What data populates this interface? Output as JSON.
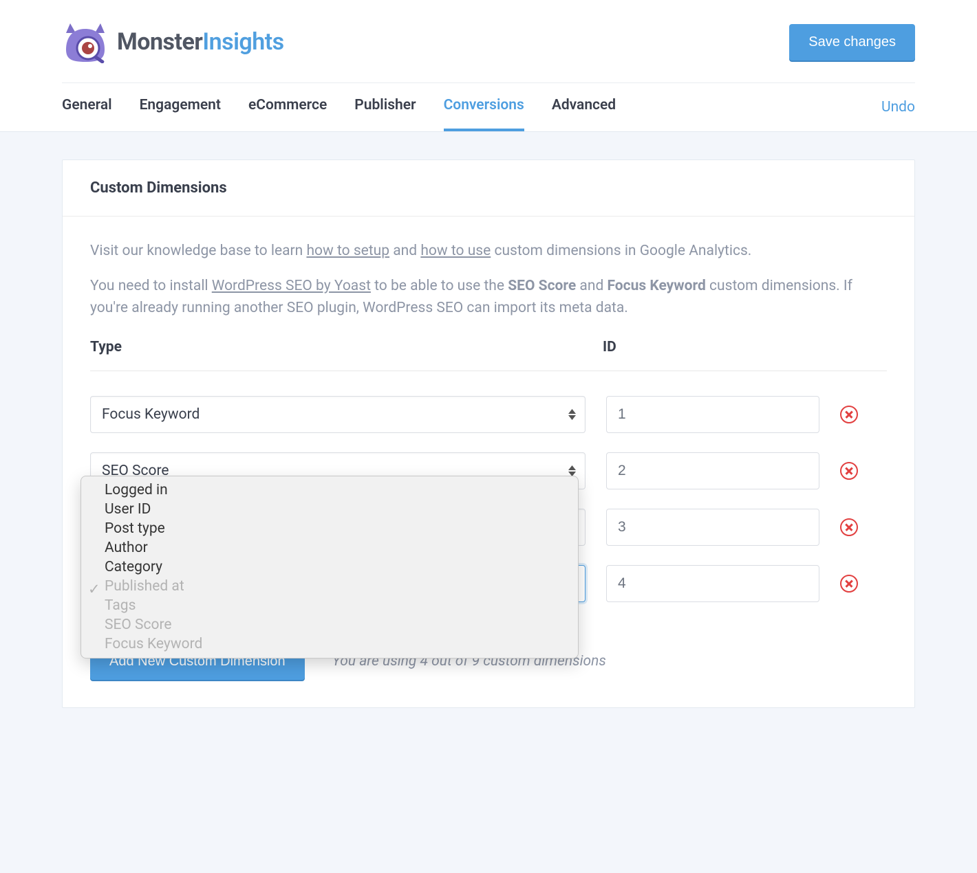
{
  "header": {
    "brand_main": "Monster",
    "brand_accent": "Insights",
    "save_button": "Save changes",
    "undo": "Undo"
  },
  "tabs": [
    {
      "label": "General",
      "active": false
    },
    {
      "label": "Engagement",
      "active": false
    },
    {
      "label": "eCommerce",
      "active": false
    },
    {
      "label": "Publisher",
      "active": false
    },
    {
      "label": "Conversions",
      "active": true
    },
    {
      "label": "Advanced",
      "active": false
    }
  ],
  "panel": {
    "title": "Custom Dimensions",
    "help1_before": "Visit our knowledge base to learn ",
    "help1_link1": "how to setup",
    "help1_mid": " and ",
    "help1_link2": "how to use",
    "help1_after": " custom dimensions in Google Analytics.",
    "help2_before": "You need to install ",
    "help2_link": "WordPress SEO by Yoast",
    "help2_mid1": " to be able to use the ",
    "help2_strong1": "SEO Score",
    "help2_mid2": " and ",
    "help2_strong2": "Focus Keyword",
    "help2_after": " custom dimensions. If you're already running another SEO plugin, WordPress SEO can import its meta data.",
    "col_type": "Type",
    "col_id": "ID"
  },
  "rows": [
    {
      "type": "Focus Keyword",
      "id": "1"
    },
    {
      "type": "SEO Score",
      "id": "2"
    },
    {
      "type": "",
      "id": "3"
    },
    {
      "type": "",
      "id": "4"
    }
  ],
  "dropdown": {
    "options": [
      {
        "label": "Logged in",
        "disabled": false,
        "checked": false
      },
      {
        "label": "User ID",
        "disabled": false,
        "checked": false
      },
      {
        "label": "Post type",
        "disabled": false,
        "checked": false
      },
      {
        "label": "Author",
        "disabled": false,
        "checked": false
      },
      {
        "label": "Category",
        "disabled": false,
        "checked": false
      },
      {
        "label": "Published at",
        "disabled": true,
        "checked": true
      },
      {
        "label": "Tags",
        "disabled": true,
        "checked": false
      },
      {
        "label": "SEO Score",
        "disabled": true,
        "checked": false
      },
      {
        "label": "Focus Keyword",
        "disabled": true,
        "checked": false
      }
    ]
  },
  "footer": {
    "add_button": "Add New Custom Dimension",
    "usage": "You are using 4 out of 9 custom dimensions"
  }
}
